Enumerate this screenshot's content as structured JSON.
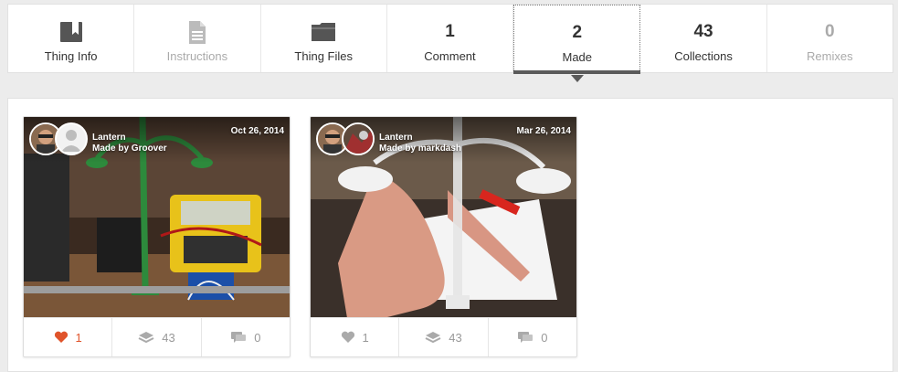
{
  "tabs": [
    {
      "id": "thing-info",
      "label": "Thing Info",
      "icon": "book-icon",
      "disabled": false,
      "active": false
    },
    {
      "id": "instructions",
      "label": "Instructions",
      "icon": "document-icon",
      "disabled": true,
      "active": false
    },
    {
      "id": "thing-files",
      "label": "Thing Files",
      "icon": "folder-icon",
      "disabled": false,
      "active": false
    },
    {
      "id": "comment",
      "label": "Comment",
      "count": "1",
      "disabled": false,
      "active": false
    },
    {
      "id": "made",
      "label": "Made",
      "count": "2",
      "disabled": false,
      "active": true
    },
    {
      "id": "collections",
      "label": "Collections",
      "count": "43",
      "disabled": false,
      "active": false
    },
    {
      "id": "remixes",
      "label": "Remixes",
      "count": "0",
      "disabled": true,
      "active": false
    }
  ],
  "makes": [
    {
      "thing": "Lantern",
      "made_by": "Made by Groover",
      "date": "Oct 26, 2014",
      "likes": "1",
      "collections": "43",
      "comments": "0",
      "liked": true
    },
    {
      "thing": "Lantern",
      "made_by": "Made by markdash",
      "date": "Mar 26, 2014",
      "likes": "1",
      "collections": "43",
      "comments": "0",
      "liked": false
    }
  ],
  "colors": {
    "accent": "#e0542b",
    "muted": "#999999",
    "active_bar": "#5a5a5a"
  }
}
